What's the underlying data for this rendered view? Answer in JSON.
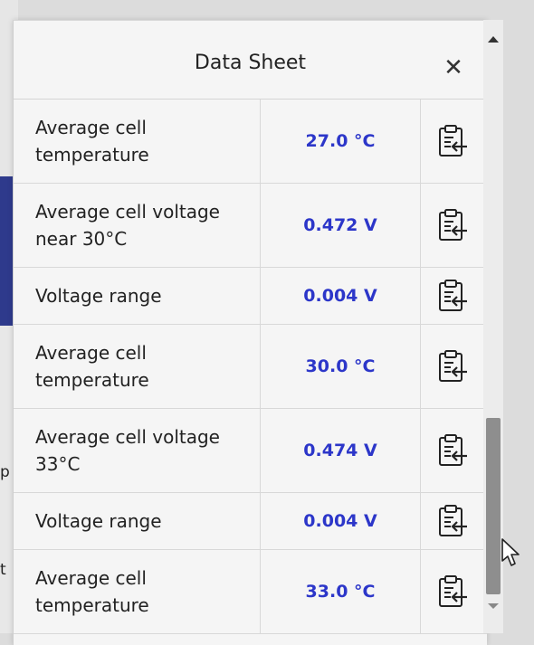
{
  "background": {
    "fragment_1": "p",
    "fragment_2": "t"
  },
  "dialog": {
    "title": "Data Sheet",
    "close_glyph": "✕"
  },
  "rows": [
    {
      "label": "Average cell temperature",
      "value": "27.0 °C"
    },
    {
      "label": "Average cell voltage near 30°C",
      "value": "0.472 V"
    },
    {
      "label": "Voltage range",
      "value": "0.004 V"
    },
    {
      "label": "Average cell temperature",
      "value": "30.0 °C"
    },
    {
      "label": "Average cell voltage 33°C",
      "value": "0.474 V"
    },
    {
      "label": "Voltage range",
      "value": "0.004 V"
    },
    {
      "label": "Average cell temperature",
      "value": "33.0 °C"
    }
  ],
  "colors": {
    "value_text": "#2c36c9",
    "background_accent": "#2e3a8c"
  },
  "icons": {
    "copy": "clipboard-copy-icon",
    "close": "close-icon"
  }
}
